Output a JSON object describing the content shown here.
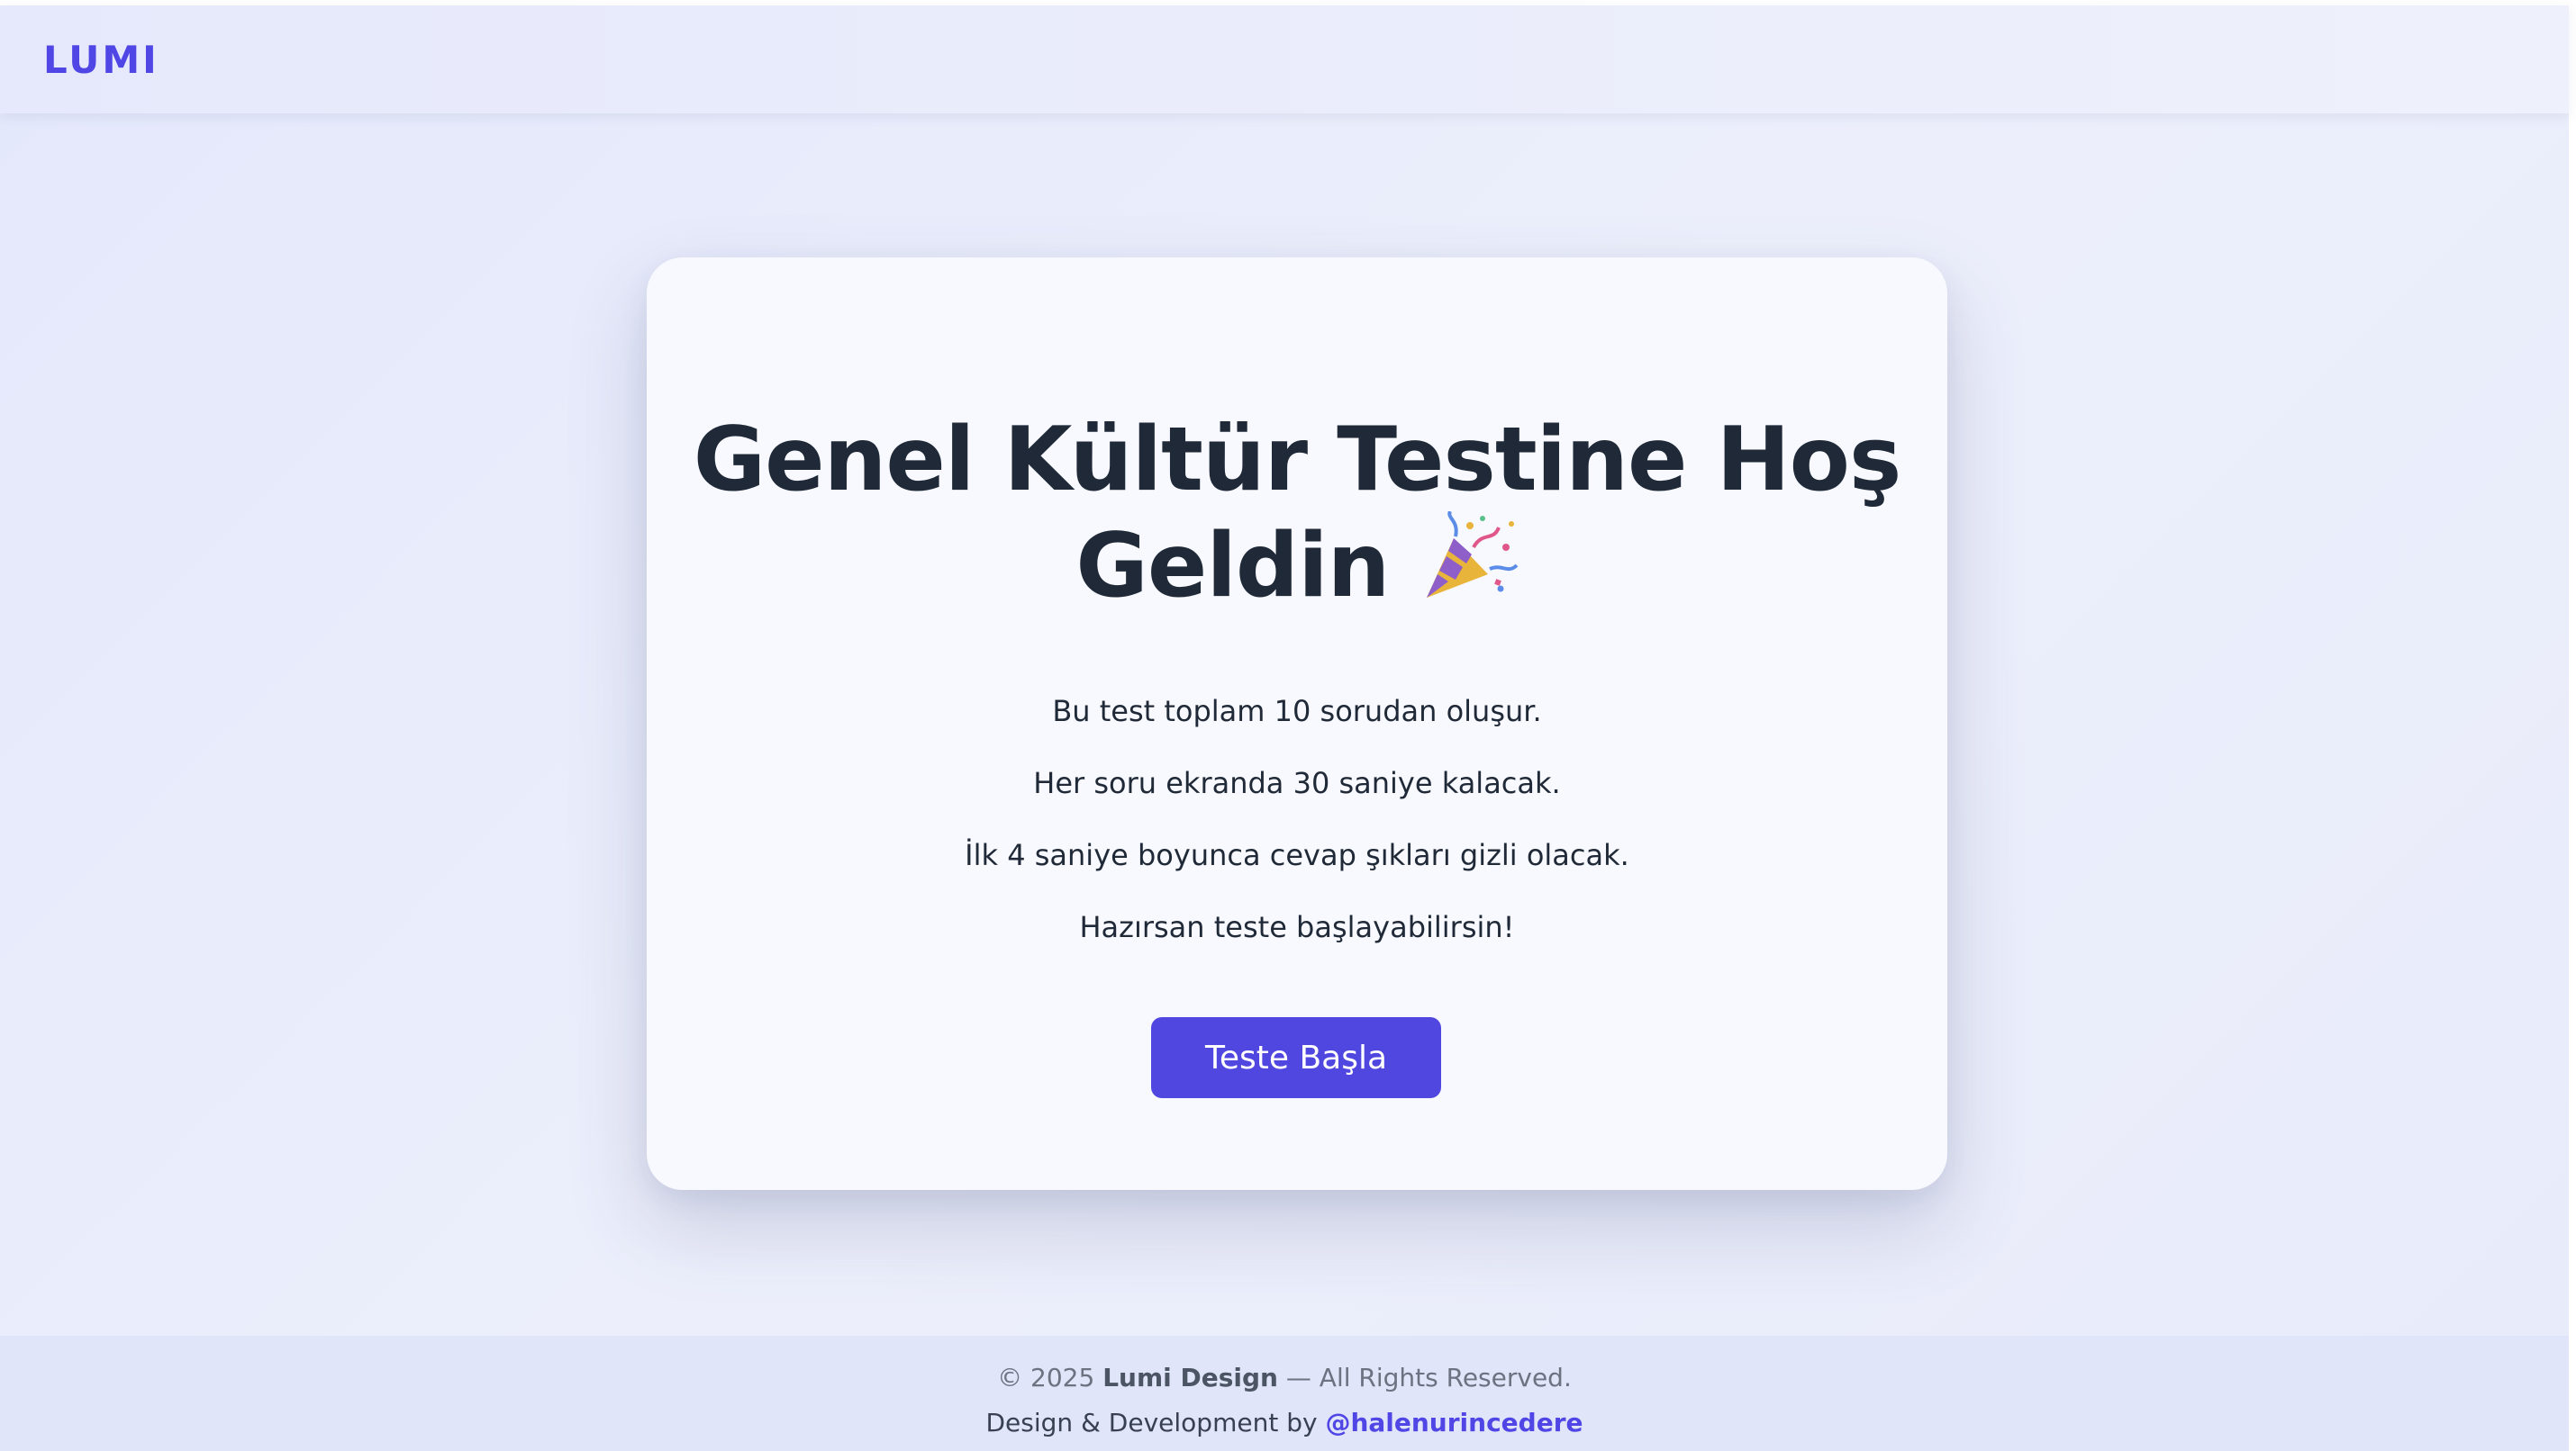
{
  "navbar": {
    "logo": "LUMI"
  },
  "card": {
    "title_line1": "Genel Kültür Testine Hoş",
    "title_line2": "Geldin",
    "title_icon": "party-popper-icon",
    "info_lines": [
      "Bu test toplam 10 sorudan oluşur.",
      "Her soru ekranda 30 saniye kalacak.",
      "İlk 4 saniye boyunca cevap şıkları gizli olacak.",
      "Hazırsan teste başlayabilirsin!"
    ],
    "start_button_label": "Teste Başla"
  },
  "footer": {
    "copyright_prefix": "© 2025",
    "brand": "Lumi Design",
    "copyright_suffix": "— All Rights Reserved.",
    "credit_prefix": "Design & Development by",
    "credit_handle": "@halenurincedere"
  },
  "colors": {
    "accent": "#4f46e5",
    "button": "#5046e0",
    "text": "#1f2937",
    "background": "#e8ebfa"
  }
}
